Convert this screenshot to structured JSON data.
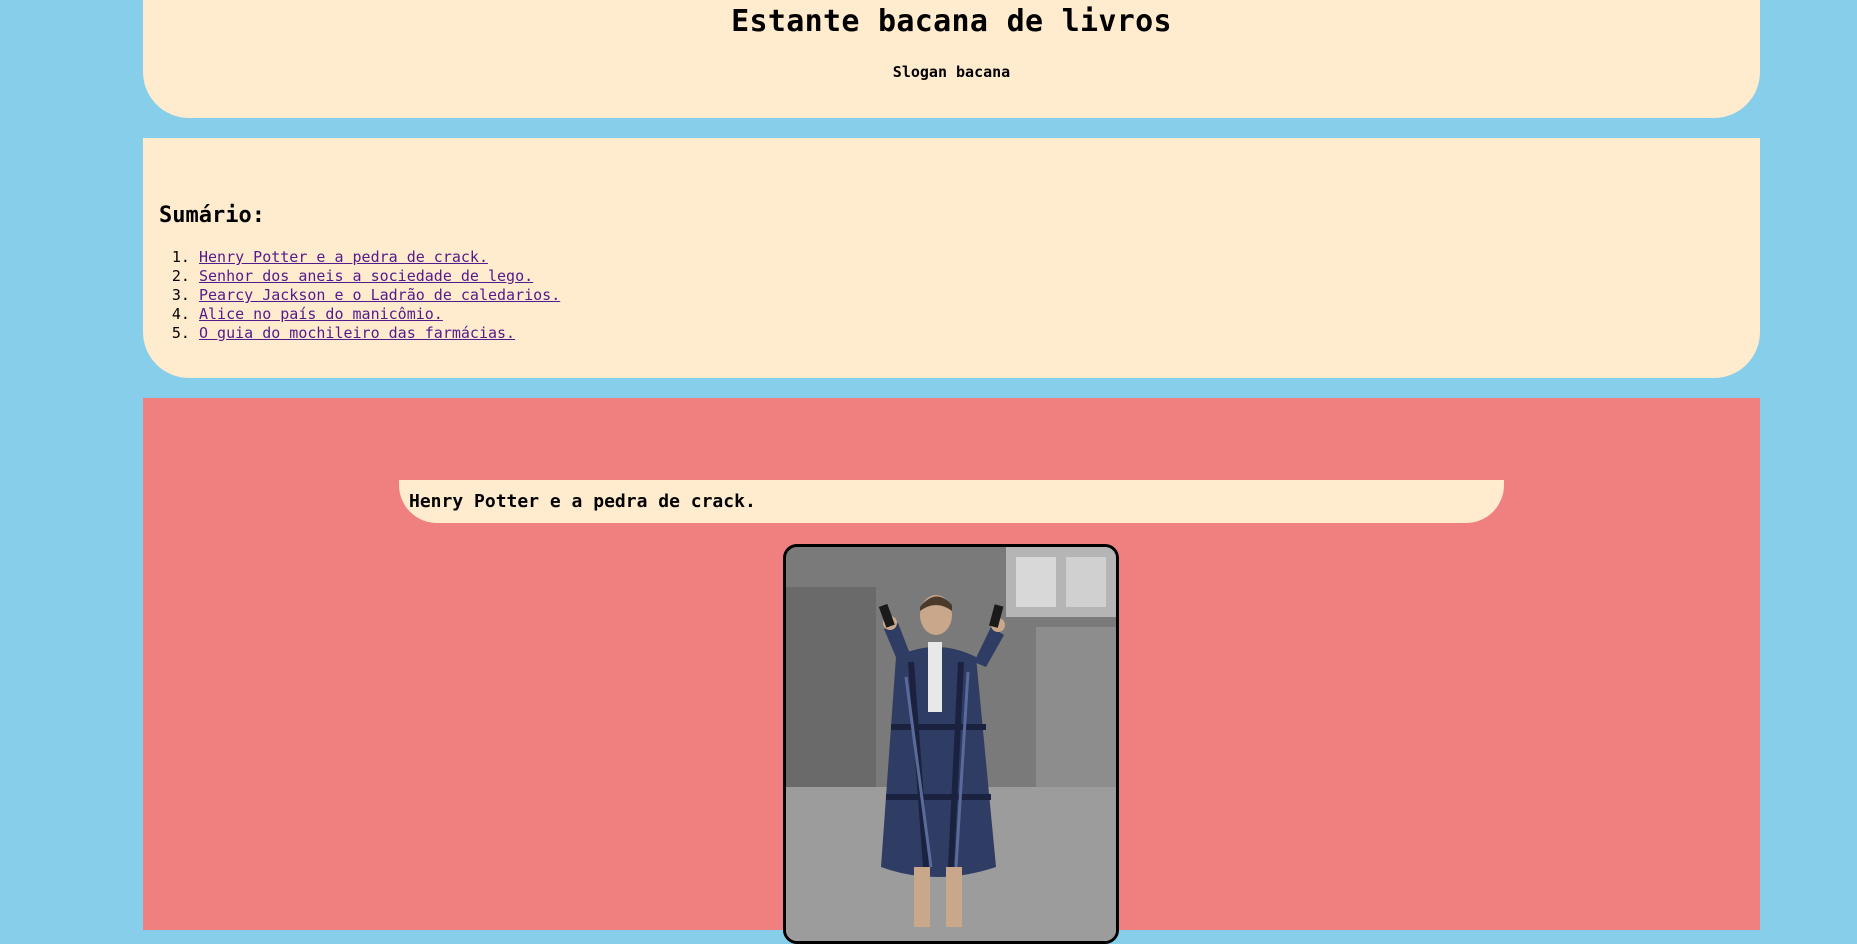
{
  "header": {
    "title": "Estante bacana de livros",
    "slogan": "Slogan bacana"
  },
  "summary": {
    "heading": "Sumário:",
    "items": [
      {
        "label": "Henry Potter e a pedra de crack."
      },
      {
        "label": "Senhor dos aneis a sociedade de lego."
      },
      {
        "label": "Pearcy Jackson e o Ladrão de caledarios."
      },
      {
        "label": "Alice no país do manicômio."
      },
      {
        "label": "O guia do mochileiro das farmácias."
      }
    ]
  },
  "book": {
    "title": "Henry Potter e a pedra de crack."
  },
  "colors": {
    "background": "#87ceeb",
    "panel": "#ffebcd",
    "content": "#f08080",
    "link_visited": "#551a8b"
  }
}
